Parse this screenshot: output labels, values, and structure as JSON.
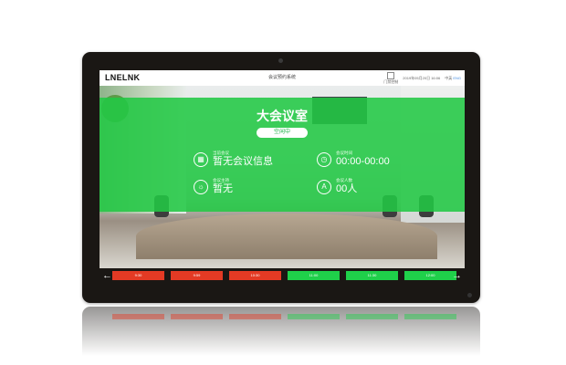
{
  "app": {
    "logo_text": "LNELNK",
    "system_title": "会议预约系统"
  },
  "topbar": {
    "icon_label": "门禁控制",
    "date_text": "2019年05月20日 16:06",
    "lang_label": "中英",
    "lang_alt": "ENG"
  },
  "room": {
    "name": "大会议室",
    "status": "空闲中"
  },
  "info": {
    "current_meeting_label": "当前会议",
    "current_meeting_value": "暂无会议信息",
    "meeting_time_label": "会议时间",
    "meeting_time_value": "00:00-00:00",
    "host_label": "会议主持",
    "host_value": "暂无",
    "attendees_label": "会议人数",
    "attendees_value": "00人"
  },
  "colors": {
    "accent_green": "#22c844",
    "busy_red": "#e43a24",
    "free_green": "#1fd04a"
  },
  "timeline": {
    "prev_icon": "←",
    "next_icon": "→",
    "slots": [
      {
        "label": "9:30",
        "state": "busy"
      },
      {
        "label": "9:59",
        "state": "busy"
      },
      {
        "label": "10:30",
        "state": "busy"
      },
      {
        "label": "11:00",
        "state": "free"
      },
      {
        "label": "11:30",
        "state": "free"
      },
      {
        "label": "12:00",
        "state": "free"
      }
    ]
  },
  "icons": {
    "calendar": "▦",
    "clock": "◷",
    "host": "☼",
    "people": "A"
  }
}
